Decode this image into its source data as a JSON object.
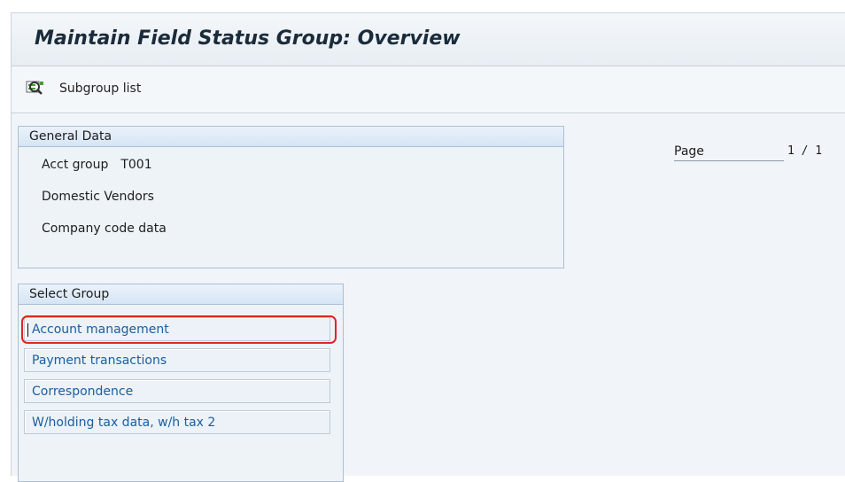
{
  "title": "Maintain Field Status Group: Overview",
  "toolbar": {
    "subgroup_list_label": "Subgroup list",
    "subgroup_list_icon": "subgroup-list-icon"
  },
  "pager": {
    "label": "Page",
    "value": "1 / 1"
  },
  "general_data": {
    "header": "General Data",
    "acct_group_label": "Acct group",
    "acct_group_value": "T001",
    "description": "Domestic Vendors",
    "section": "Company code data"
  },
  "select_group": {
    "header": "Select Group",
    "items": [
      {
        "label": "Account management",
        "highlighted": true
      },
      {
        "label": "Payment transactions"
      },
      {
        "label": "Correspondence"
      },
      {
        "label": "W/holding tax data, w/h tax 2"
      }
    ]
  },
  "colors": {
    "link_text": "#1a5fa0",
    "highlight": "#e02424",
    "group_border": "#a9bfd4"
  }
}
